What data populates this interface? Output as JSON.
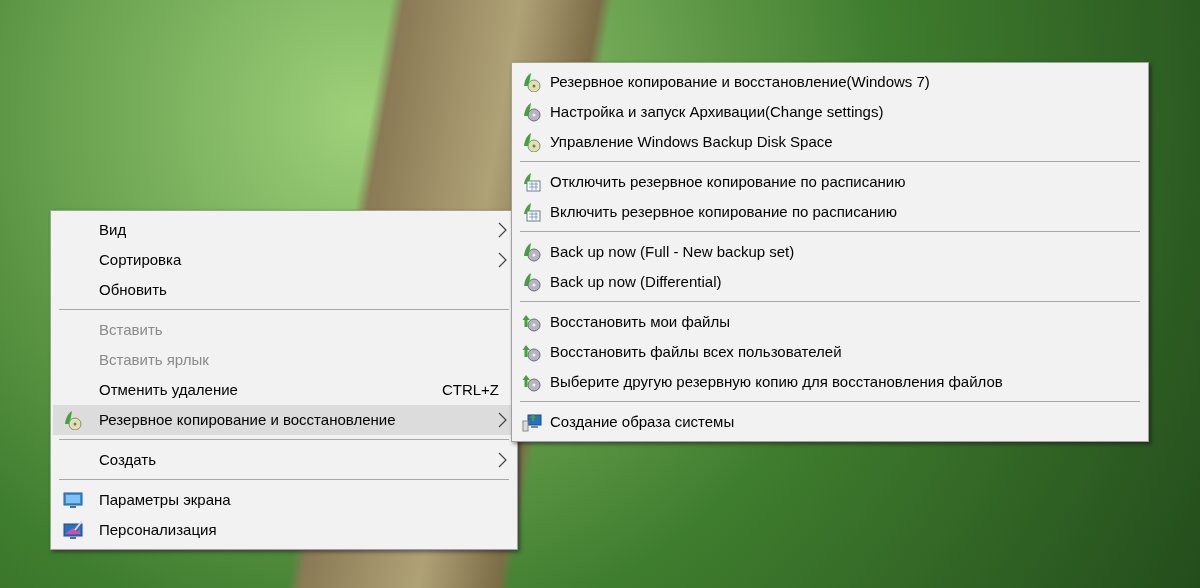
{
  "desktop": {
    "menu": {
      "items": [
        {
          "kind": "item",
          "label": "Вид",
          "submenu": true,
          "disabled": false,
          "selected": false
        },
        {
          "kind": "item",
          "label": "Сортировка",
          "submenu": true,
          "disabled": false,
          "selected": false
        },
        {
          "kind": "item",
          "label": "Обновить",
          "submenu": false,
          "disabled": false,
          "selected": false
        },
        {
          "kind": "separator"
        },
        {
          "kind": "item",
          "label": "Вставить",
          "submenu": false,
          "disabled": true,
          "selected": false
        },
        {
          "kind": "item",
          "label": "Вставить ярлык",
          "submenu": false,
          "disabled": true,
          "selected": false
        },
        {
          "kind": "item",
          "label": "Отменить удаление",
          "shortcut": "CTRL+Z",
          "submenu": false,
          "disabled": false,
          "selected": false
        },
        {
          "kind": "backup",
          "label": "Резервное копирование и восстановление",
          "submenu": true,
          "disabled": false,
          "selected": true
        },
        {
          "kind": "separator"
        },
        {
          "kind": "item",
          "label": "Создать",
          "submenu": true,
          "disabled": false,
          "selected": false
        },
        {
          "kind": "separator"
        },
        {
          "kind": "display",
          "label": "Параметры экрана",
          "submenu": false,
          "disabled": false,
          "selected": false
        },
        {
          "kind": "personalize",
          "label": "Персонализация",
          "submenu": false,
          "disabled": false,
          "selected": false
        }
      ]
    },
    "submenu": {
      "items": [
        {
          "kind": "backup",
          "label": "Резервное копирование и восстановление(Windows 7)",
          "disabled": false,
          "selected": false
        },
        {
          "kind": "disc",
          "label": "Настройка и запуск Архивации(Change settings)",
          "disabled": false,
          "selected": false
        },
        {
          "kind": "backup",
          "label": "Управление Windows Backup Disk Space",
          "disabled": false,
          "selected": false
        },
        {
          "kind": "separator"
        },
        {
          "kind": "schedule",
          "label": "Отключить резервное копирование по расписанию",
          "disabled": false,
          "selected": false
        },
        {
          "kind": "schedule",
          "label": "Включить резервное копирование по расписанию",
          "disabled": false,
          "selected": false
        },
        {
          "kind": "separator"
        },
        {
          "kind": "disc",
          "label": "Back up now (Full - New backup set)",
          "disabled": false,
          "selected": false
        },
        {
          "kind": "disc",
          "label": "Back up now (Differential)",
          "disabled": false,
          "selected": false
        },
        {
          "kind": "separator"
        },
        {
          "kind": "restore",
          "label": "Восстановить мои файлы",
          "disabled": false,
          "selected": false
        },
        {
          "kind": "restore",
          "label": "Восстановить файлы всех пользователей",
          "disabled": false,
          "selected": false
        },
        {
          "kind": "restore",
          "label": "Выберите другую резервную копию для восстановления файлов",
          "disabled": false,
          "selected": false
        },
        {
          "kind": "separator"
        },
        {
          "kind": "image",
          "label": "Создание образа системы",
          "disabled": false,
          "selected": false
        }
      ]
    }
  }
}
